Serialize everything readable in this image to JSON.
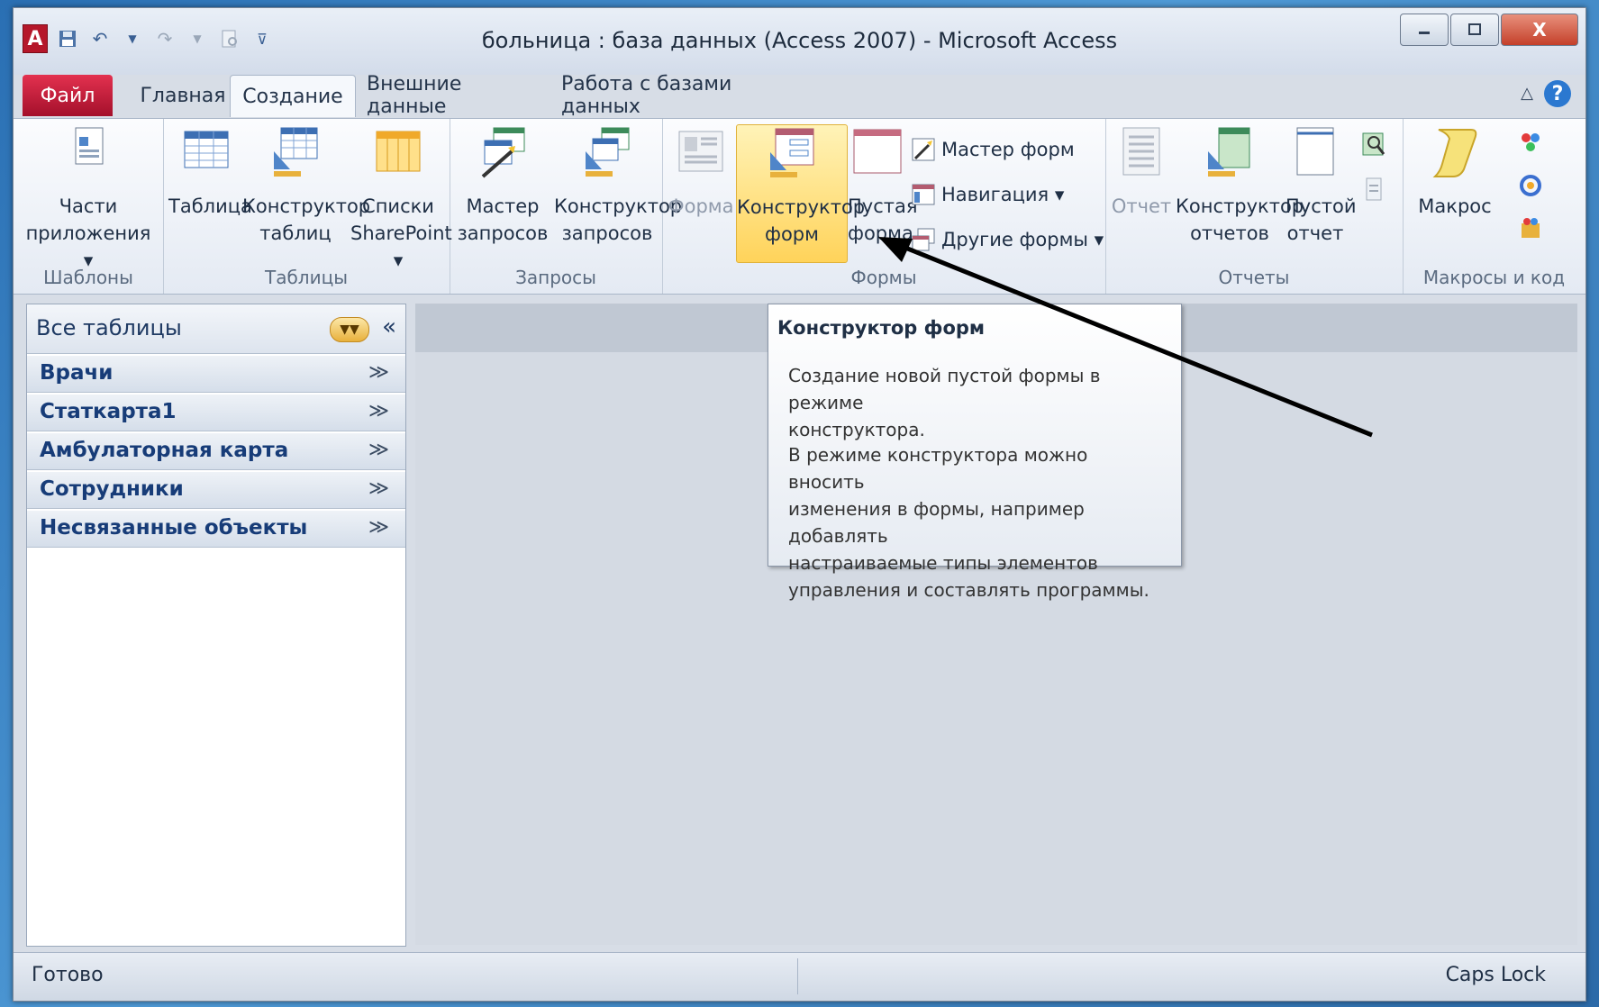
{
  "titlebar": {
    "title": "больница : база данных (Access 2007)  -  Microsoft Access",
    "app_icon_label": "A",
    "close_label": "X"
  },
  "tabs": {
    "file": "Файл",
    "home": "Главная",
    "create": "Создание",
    "external": "Внешние данные",
    "database": "Работа с базами данных"
  },
  "ribbon": {
    "templates": {
      "label": "Шаблоны",
      "parts": [
        "Части",
        "приложения ▾"
      ]
    },
    "tables": {
      "label": "Таблицы",
      "table": "Таблица",
      "designer": [
        "Конструктор",
        "таблиц"
      ],
      "sharepoint": [
        "Списки",
        "SharePoint ▾"
      ]
    },
    "queries": {
      "label": "Запросы",
      "wizard": [
        "Мастер",
        "запросов"
      ],
      "designer": [
        "Конструктор",
        "запросов"
      ]
    },
    "forms": {
      "label": "Формы",
      "form": "Форма",
      "designer": [
        "Конструктор",
        "форм"
      ],
      "blank": [
        "Пустая",
        "форма"
      ],
      "wizard": "Мастер форм",
      "navigation": "Навигация ▾",
      "other": "Другие формы ▾"
    },
    "reports": {
      "label": "Отчеты",
      "report": "Отчет",
      "designer": [
        "Конструктор",
        "отчетов"
      ],
      "blank": [
        "Пустой",
        "отчет"
      ]
    },
    "macros": {
      "label": "Макросы и код",
      "macro": "Макрос"
    }
  },
  "nav": {
    "title": "Все таблицы",
    "collapse": "«",
    "groups": [
      {
        "label": "Врачи"
      },
      {
        "label": "Статкарта1"
      },
      {
        "label": "Амбулаторная карта"
      },
      {
        "label": "Сотрудники"
      },
      {
        "label": "Несвязанные объекты"
      }
    ],
    "chevron": "≫"
  },
  "tooltip": {
    "title": "Конструктор форм",
    "p1": [
      "Создание новой пустой формы в режиме",
      "конструктора."
    ],
    "p2": [
      "В режиме конструктора можно вносить",
      "изменения в формы, например добавлять",
      "настраиваемые типы элементов",
      "управления и составлять программы."
    ]
  },
  "status": {
    "left": "Готово",
    "right": "Caps Lock"
  },
  "colors": {
    "file_tab": "#c41a3a",
    "highlight": "#ffd35a",
    "accent": "#173c78"
  }
}
